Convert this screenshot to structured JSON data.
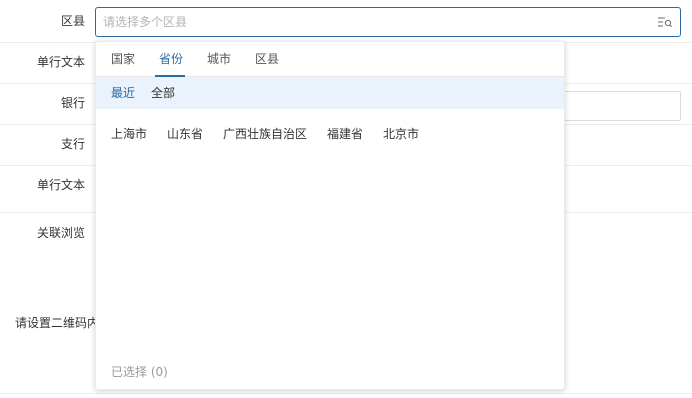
{
  "form": {
    "district_label": "区县",
    "single_text_label_1": "单行文本",
    "bank_label": "银行",
    "branch_label": "支行",
    "single_text_label_2": "单行文本",
    "related_browse_label": "关联浏览",
    "qrcode_label": "请设置二维码内容"
  },
  "select": {
    "placeholder": "请选择多个区县",
    "icon": "list-search-icon"
  },
  "dropdown": {
    "tabs": [
      "国家",
      "省份",
      "城市",
      "区县"
    ],
    "active_tab": "省份",
    "subtabs": [
      "最近",
      "全部"
    ],
    "active_subtab": "最近",
    "options": [
      "上海市",
      "山东省",
      "广西壮族自治区",
      "福建省",
      "北京市"
    ],
    "selected_count_text": "已选择 (0)"
  },
  "colors": {
    "accent": "#2b6ba3",
    "subtab_bg": "#eaf2fb",
    "placeholder": "#b3b3b3",
    "muted": "#999999"
  }
}
